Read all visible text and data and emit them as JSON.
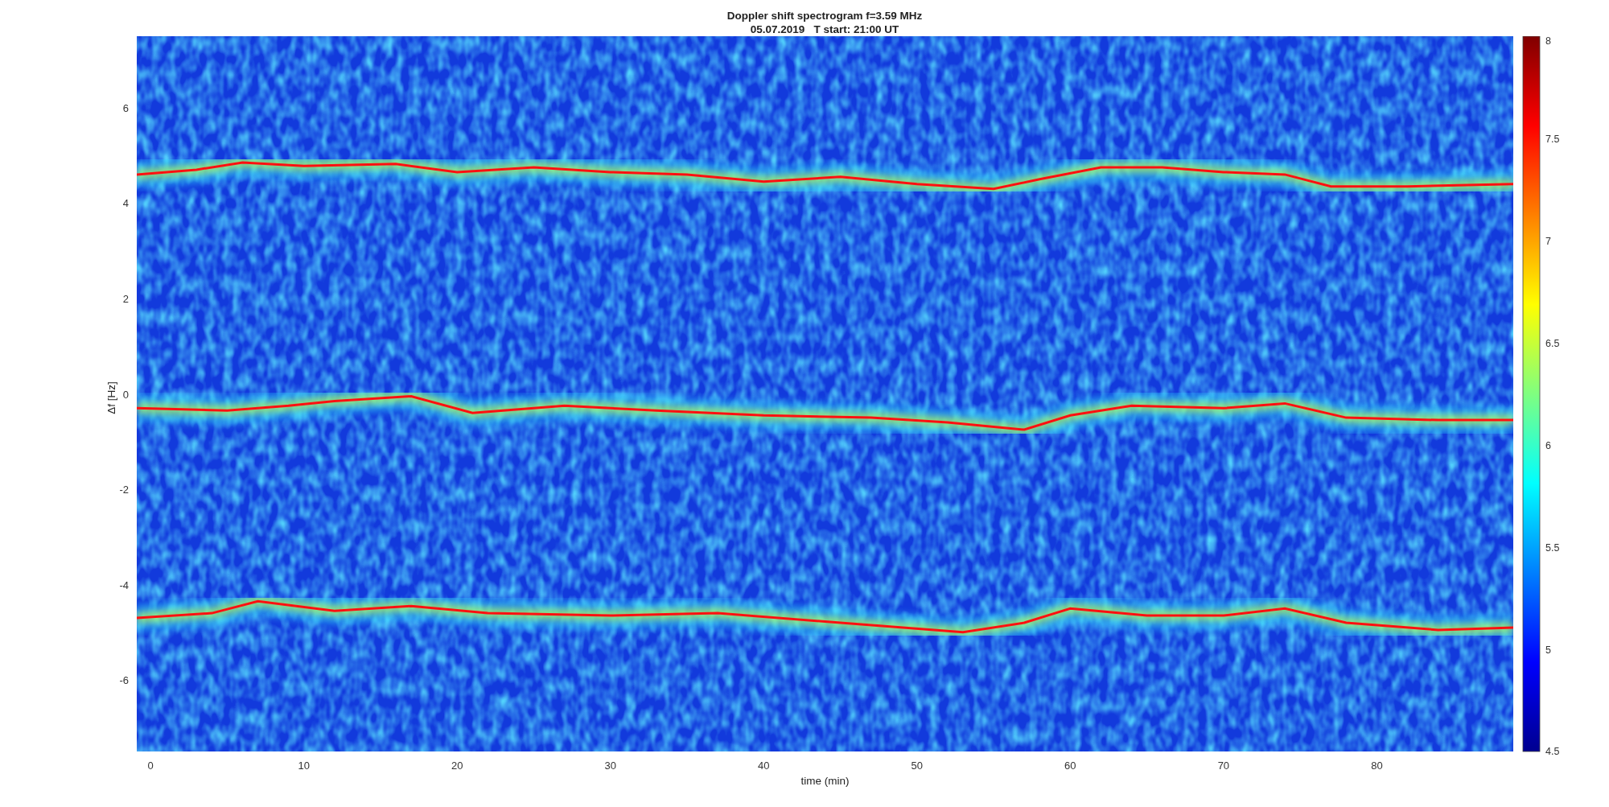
{
  "figure": {
    "title": [
      "Doppler shift spectrogram f=3.59 MHz",
      "05.07.2019   T start: 21:00 UT"
    ]
  },
  "axes": {
    "xlabel": "time (min)",
    "ylabel": "Δf [Hz]",
    "xticks": [
      "0",
      "10",
      "20",
      "30",
      "40",
      "50",
      "60",
      "70",
      "80"
    ],
    "yticks": [
      "6",
      "4",
      "2",
      "0",
      "-2",
      "-4",
      "-6"
    ]
  },
  "colorbar": {
    "ticks": [
      "8",
      "7.5",
      "7",
      "6.5",
      "6",
      "5.5",
      "5",
      "4.5"
    ]
  }
}
